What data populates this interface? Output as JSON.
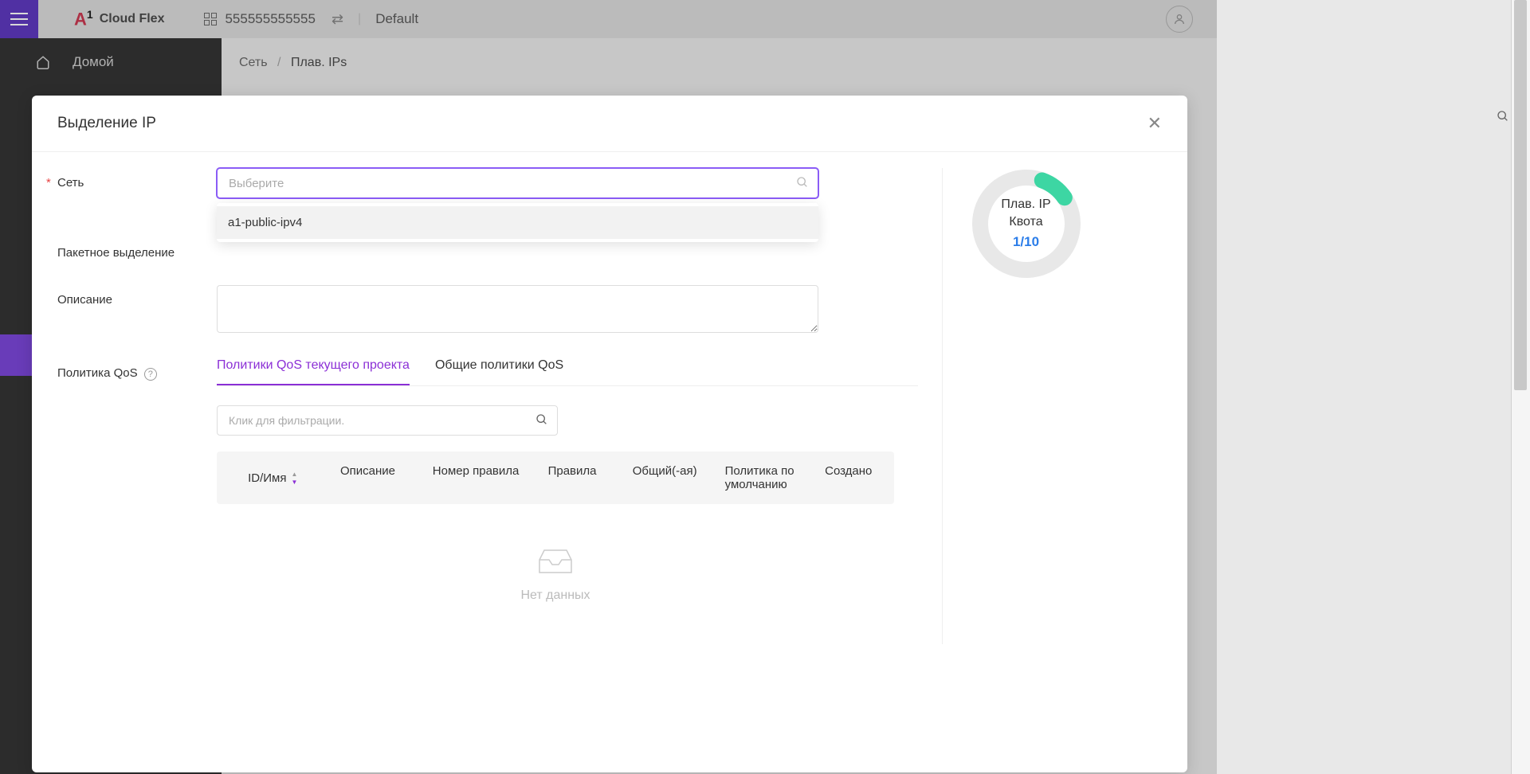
{
  "header": {
    "logoText": "Cloud Flex",
    "accountId": "555555555555",
    "projectLabel": "Default"
  },
  "sidebar": {
    "home": "Домой"
  },
  "breadcrumb": {
    "parent": "Сеть",
    "current": "Плав. IPs"
  },
  "modal": {
    "title": "Выделение IP",
    "labels": {
      "network": "Сеть",
      "batch": "Пакетное выделение",
      "description": "Описание",
      "qosPolicy": "Политика QoS"
    },
    "networkPlaceholder": "Выберите",
    "dropdownOptions": [
      "a1-public-ipv4"
    ],
    "tabs": {
      "current": "Политики QoS текущего проекта",
      "shared": "Общие политики QoS"
    },
    "filterPlaceholder": "Клик для фильтрации.",
    "tableHeaders": {
      "idName": "ID/Имя",
      "description": "Описание",
      "ruleNumber": "Номер правила",
      "rules": "Правила",
      "shared": "Общий(-ая)",
      "defaultPolicy": "Политика по умолчанию",
      "created": "Создано"
    },
    "noData": "Нет данных"
  },
  "quota": {
    "line1": "Плав. IP",
    "line2": "Квота",
    "value": "1/10"
  }
}
